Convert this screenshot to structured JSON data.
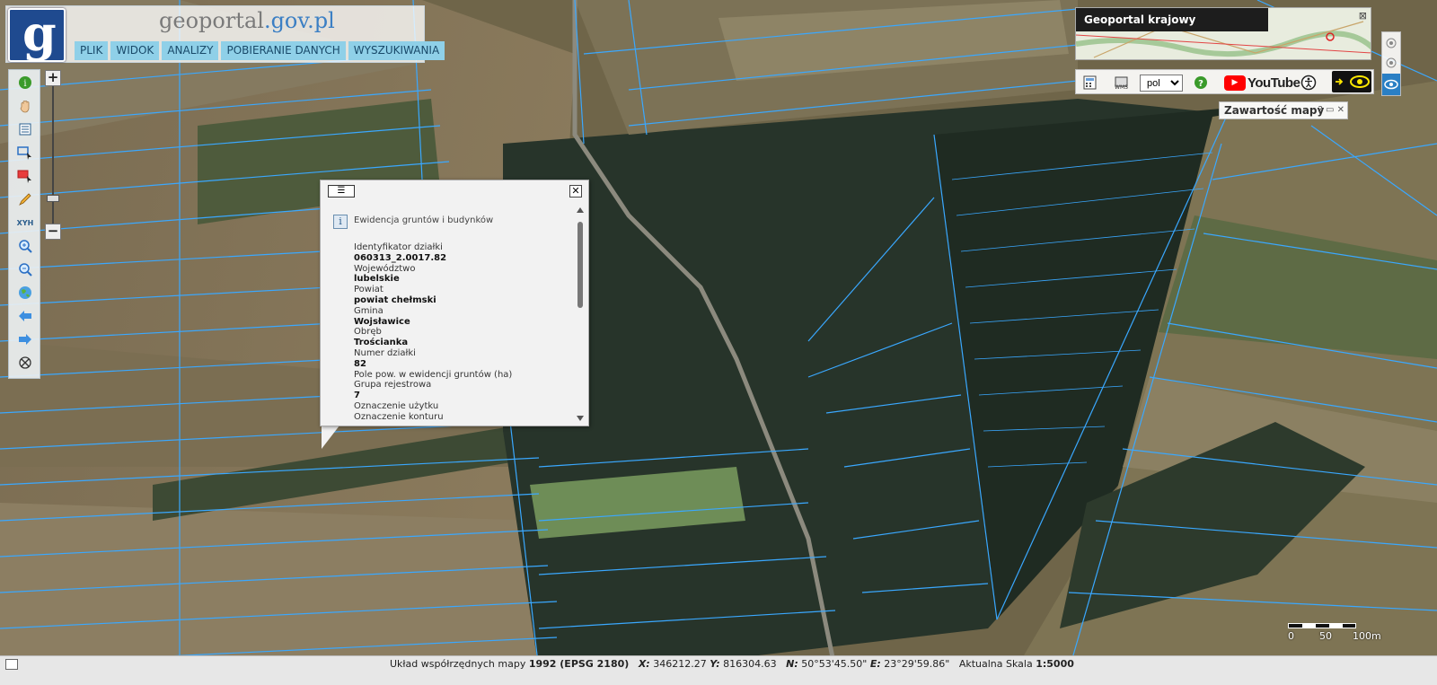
{
  "header": {
    "logo_letter": "g",
    "site_title_main": "geoportal",
    "site_title_tld": ".gov.pl",
    "menu": [
      "PLIK",
      "WIDOK",
      "ANALIZY",
      "POBIERANIE DANYCH",
      "WYSZUKIWANIA"
    ]
  },
  "toolbar": {
    "zoom_in": "+",
    "zoom_out": "−",
    "xyh_label": "XYH",
    "tools": [
      "info-icon",
      "pan-hand-icon",
      "legend-icon",
      "select-box-icon",
      "select-box-red-icon",
      "pencil-icon",
      "xyh-icon",
      "zoom-in-icon",
      "zoom-out-icon",
      "globe-icon",
      "arrow-left-icon",
      "arrow-right-icon",
      "crosshair-icon"
    ]
  },
  "popup": {
    "menu_glyph": "☰",
    "close_glyph": "✕",
    "info_glyph": "i",
    "header": "Ewidencja gruntów i budynków",
    "fields": [
      {
        "label": "Identyfikator działki",
        "value": "060313_2.0017.82"
      },
      {
        "label": "Województwo",
        "value": "lubelskie"
      },
      {
        "label": "Powiat",
        "value": "powiat chełmski"
      },
      {
        "label": "Gmina",
        "value": "Wojsławice"
      },
      {
        "label": "Obręb",
        "value": "Trościanka"
      },
      {
        "label": "Numer działki",
        "value": "82"
      },
      {
        "label": "Pole pow. w ewidencji gruntów (ha)",
        "value": ""
      },
      {
        "label": "Grupa rejestrowa",
        "value": "7"
      },
      {
        "label": "Oznaczenie użytku",
        "value": ""
      },
      {
        "label": "Oznaczenie konturu",
        "value": ""
      }
    ]
  },
  "right_panel": {
    "minimap_title": "Geoportal krajowy",
    "language": "pol",
    "youtube_label": "YouTube",
    "contents_title": "Zawartość mapy",
    "contents_buttons": "? ▭ ✕"
  },
  "scale": {
    "labels": [
      "0",
      "50",
      "100m"
    ]
  },
  "status": {
    "crs_label": "Układ współrzędnych mapy",
    "crs_value": "1992 (EPSG 2180)",
    "x_label": "X:",
    "x_value": "346212.27",
    "y_label": "Y:",
    "y_value": "816304.63",
    "n_label": "N:",
    "n_value": "50°53'45.50\"",
    "e_label": "E:",
    "e_value": "23°29'59.86\"",
    "scale_label": "Aktualna Skala",
    "scale_value": "1:5000"
  },
  "colors": {
    "parcel_lines": "#3aa8ff",
    "menu_bg": "#8fd0e8",
    "logo_bg": "#1f4a8f"
  }
}
